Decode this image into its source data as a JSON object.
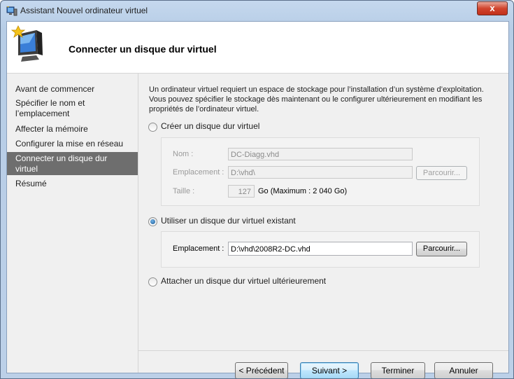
{
  "window": {
    "title": "Assistant Nouvel ordinateur virtuel",
    "close_label": "x"
  },
  "header": {
    "title": "Connecter un disque dur virtuel"
  },
  "sidebar": {
    "items": [
      {
        "label": "Avant de commencer"
      },
      {
        "label": "Spécifier le nom et l’emplacement"
      },
      {
        "label": "Affecter la mémoire"
      },
      {
        "label": "Configurer la mise en réseau"
      },
      {
        "label": "Connecter un disque dur virtuel"
      },
      {
        "label": "Résumé"
      }
    ],
    "active_index": 4
  },
  "main": {
    "description": "Un ordinateur virtuel requiert un espace de stockage pour l’installation d’un système d’exploitation. Vous pouvez spécifier le stockage dès maintenant ou le configurer ultérieurement en modifiant les propriétés de l’ordinateur virtuel.",
    "options": {
      "create": {
        "label": "Créer un disque dur virtuel",
        "checked": false,
        "name_label": "Nom :",
        "name_value": "DC-Diagg.vhd",
        "location_label": "Emplacement :",
        "location_value": "D:\\vhd\\",
        "browse_label": "Parcourir...",
        "size_label": "Taille :",
        "size_value": "127",
        "size_unit": "Go (Maximum : 2 040 Go)"
      },
      "existing": {
        "label": "Utiliser un disque dur virtuel existant",
        "checked": true,
        "location_label": "Emplacement :",
        "location_value": "D:\\vhd\\2008R2-DC.vhd",
        "browse_label": "Parcourir..."
      },
      "later": {
        "label": "Attacher un disque dur virtuel ultérieurement",
        "checked": false
      }
    }
  },
  "footer": {
    "previous": "< Précédent",
    "next": "Suivant >",
    "finish": "Terminer",
    "cancel": "Annuler"
  }
}
